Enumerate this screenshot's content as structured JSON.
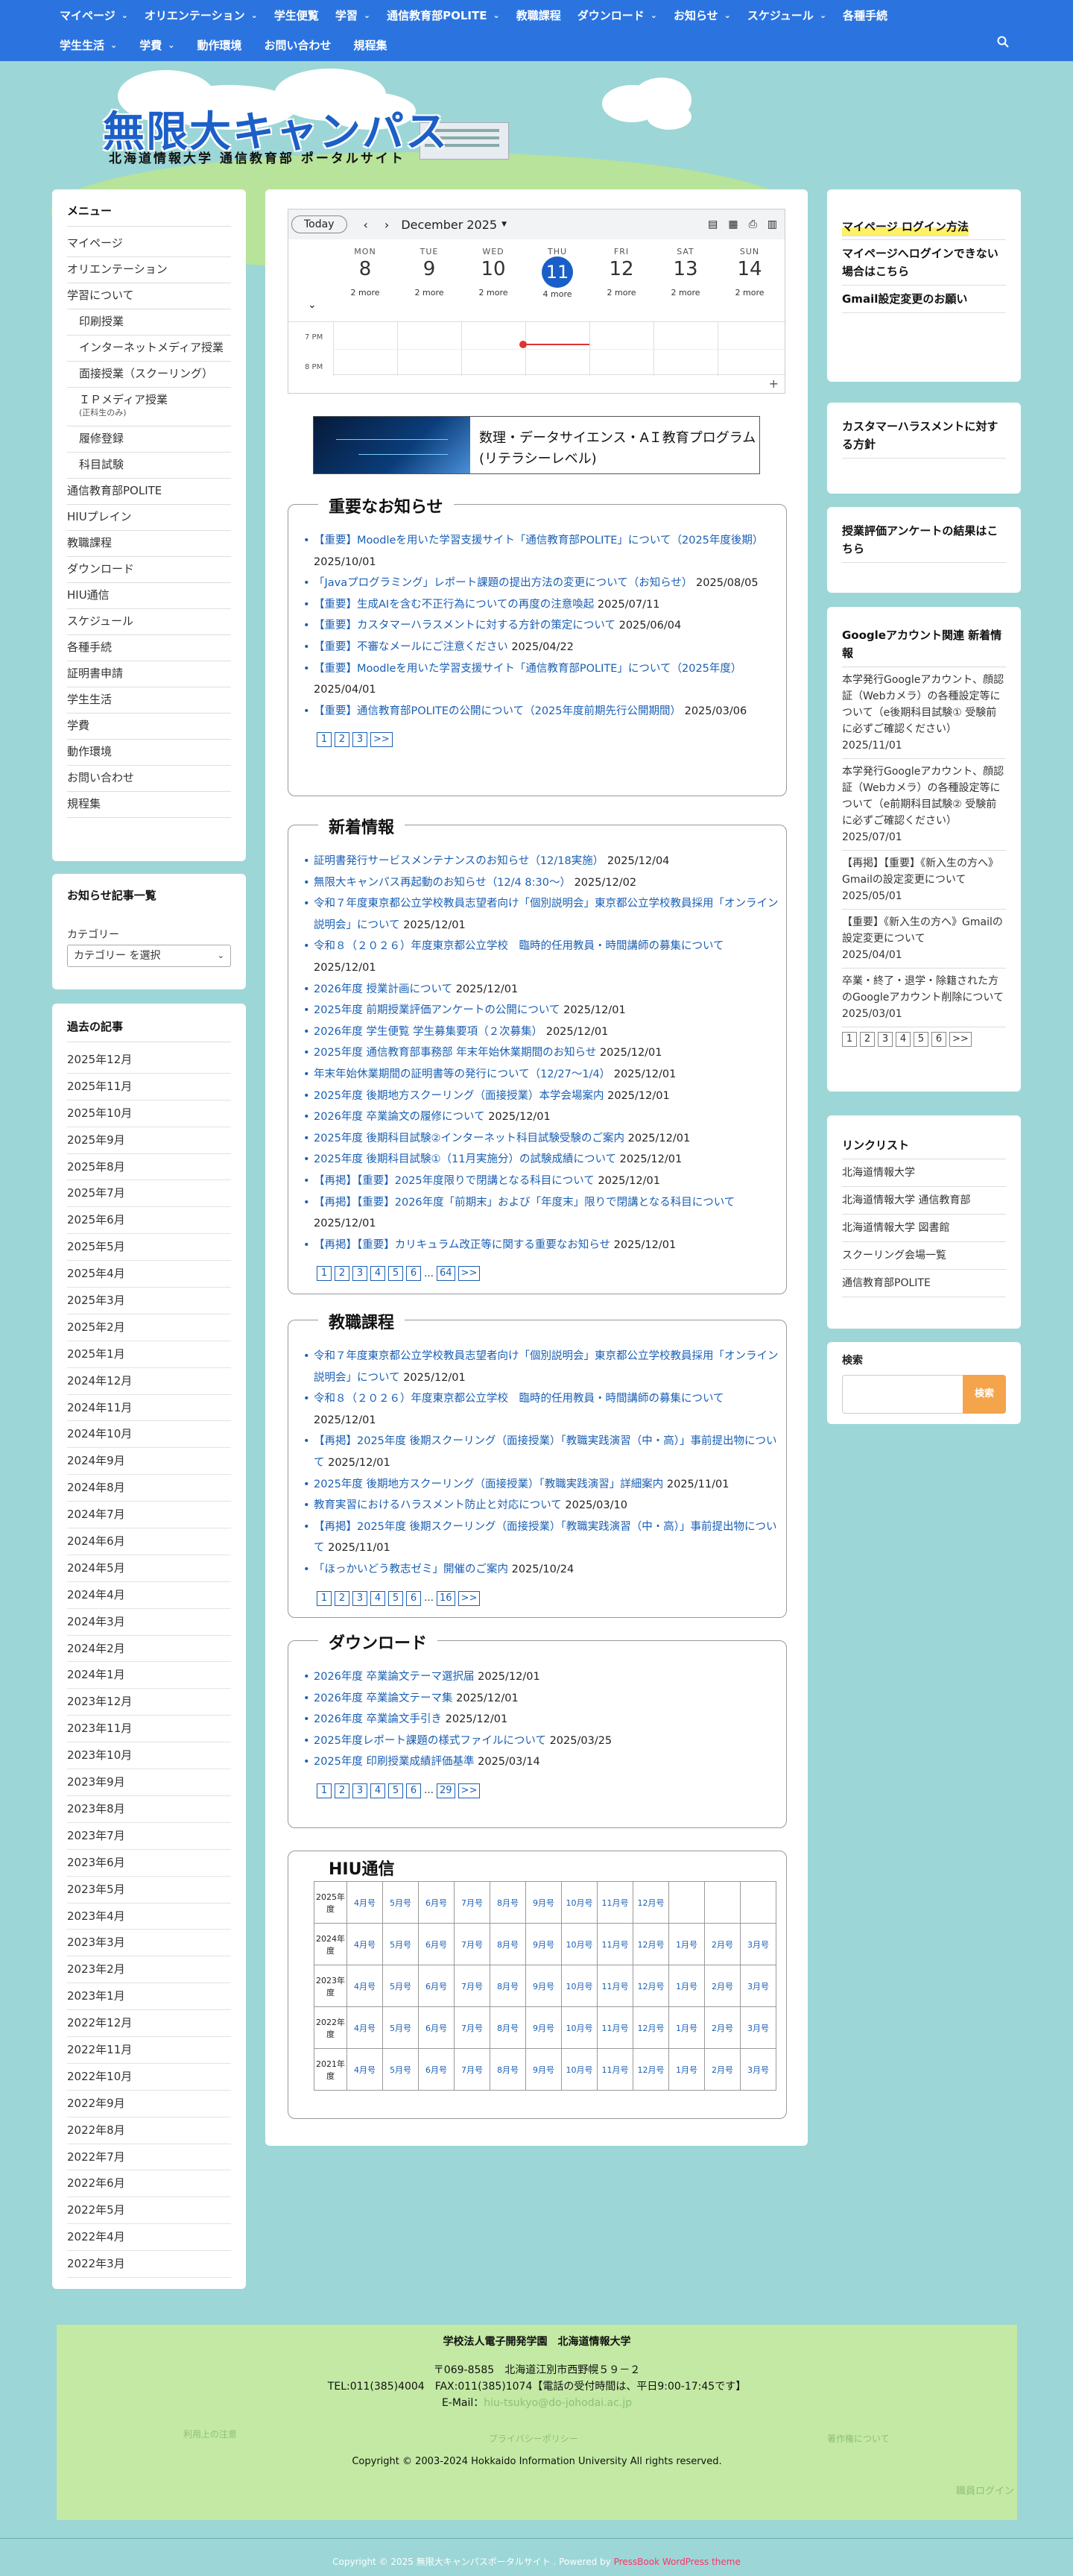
{
  "nav": {
    "row1": [
      "マイページ",
      "オリエンテーション",
      "学生便覧",
      "学習",
      "通信教育部POLITE",
      "教職課程",
      "ダウンロード",
      "お知らせ",
      "スケジュール",
      "各種手続"
    ],
    "row1_dropdown": [
      true,
      true,
      false,
      true,
      true,
      false,
      true,
      true,
      true,
      false
    ],
    "row2": [
      "学生生活",
      "学費",
      "動作環境",
      "お問い合わせ",
      "規程集"
    ],
    "row2_dropdown": [
      true,
      true,
      false,
      false,
      false
    ],
    "search_icon": "search-icon"
  },
  "header": {
    "logo_title": "無限大キャンパス",
    "logo_subtitle": "北海道情報大学 通信教育部 ポータルサイト"
  },
  "left_menu": {
    "title": "メニュー",
    "items": [
      {
        "label": "マイページ",
        "sub": false
      },
      {
        "label": "オリエンテーション",
        "sub": false
      },
      {
        "label": "学習について",
        "sub": false
      },
      {
        "label": "印刷授業",
        "sub": true
      },
      {
        "label": "インターネットメディア授業",
        "sub": true
      },
      {
        "label": "面接授業（スクーリング）",
        "sub": true
      },
      {
        "label": "ＩＰメディア授業",
        "note": "(正科生のみ)",
        "sub": true
      },
      {
        "label": "履修登録",
        "sub": true
      },
      {
        "label": "科目試験",
        "sub": true
      },
      {
        "label": "通信教育部POLITE",
        "sub": false
      },
      {
        "label": "HIUプレイン",
        "sub": false
      },
      {
        "label": "教職課程",
        "sub": false
      },
      {
        "label": "ダウンロード",
        "sub": false
      },
      {
        "label": "HIU通信",
        "sub": false
      },
      {
        "label": "スケジュール",
        "sub": false
      },
      {
        "label": "各種手続",
        "sub": false
      },
      {
        "label": "証明書申請",
        "sub": false
      },
      {
        "label": "学生生活",
        "sub": false
      },
      {
        "label": "学費",
        "sub": false
      },
      {
        "label": "動作環境",
        "sub": false
      },
      {
        "label": "お問い合わせ",
        "sub": false
      },
      {
        "label": "規程集",
        "sub": false
      }
    ]
  },
  "category": {
    "title": "お知らせ記事一覧",
    "label": "カテゴリー",
    "select_value": "カテゴリー を選択"
  },
  "archive": {
    "title": "過去の記事",
    "items": [
      "2025年12月",
      "2025年11月",
      "2025年10月",
      "2025年9月",
      "2025年8月",
      "2025年7月",
      "2025年6月",
      "2025年5月",
      "2025年4月",
      "2025年3月",
      "2025年2月",
      "2025年1月",
      "2024年12月",
      "2024年11月",
      "2024年10月",
      "2024年9月",
      "2024年8月",
      "2024年7月",
      "2024年6月",
      "2024年5月",
      "2024年4月",
      "2024年3月",
      "2024年2月",
      "2024年1月",
      "2023年12月",
      "2023年11月",
      "2023年10月",
      "2023年9月",
      "2023年8月",
      "2023年7月",
      "2023年6月",
      "2023年5月",
      "2023年4月",
      "2023年3月",
      "2023年2月",
      "2023年1月",
      "2022年12月",
      "2022年11月",
      "2022年10月",
      "2022年9月",
      "2022年8月",
      "2022年7月",
      "2022年6月",
      "2022年5月",
      "2022年4月",
      "2022年3月"
    ]
  },
  "calendar": {
    "today_label": "Today",
    "month": "December 2025",
    "days": [
      {
        "name": "MON",
        "num": "8",
        "more": "2 more",
        "today": false
      },
      {
        "name": "TUE",
        "num": "9",
        "more": "2 more",
        "today": false
      },
      {
        "name": "WED",
        "num": "10",
        "more": "2 more",
        "today": false
      },
      {
        "name": "THU",
        "num": "11",
        "more": "4 more",
        "today": true
      },
      {
        "name": "FRI",
        "num": "12",
        "more": "2 more",
        "today": false
      },
      {
        "name": "SAT",
        "num": "13",
        "more": "2 more",
        "today": false
      },
      {
        "name": "SUN",
        "num": "14",
        "more": "2 more",
        "today": false
      }
    ],
    "times": [
      "7 PM",
      "8 PM"
    ],
    "plus": "+"
  },
  "banner": {
    "line1": "数理・データサイエンス・AＩ教育プログラム",
    "line2": "(リテラシーレベル)"
  },
  "important": {
    "title": "重要なお知らせ",
    "items": [
      {
        "text": "【重要】Moodleを用いた学習支援サイト「通信教育部POLITE」について（2025年度後期）",
        "date": "2025/10/01"
      },
      {
        "text": "「Javaプログラミング」レポート課題の提出方法の変更について（お知らせ）",
        "date": "2025/08/05"
      },
      {
        "text": "【重要】生成AIを含む不正行為についての再度の注意喚起",
        "date": "2025/07/11"
      },
      {
        "text": "【重要】カスタマーハラスメントに対する方針の策定について",
        "date": "2025/06/04"
      },
      {
        "text": "【重要】不審なメールにご注意ください",
        "date": "2025/04/22"
      },
      {
        "text": "【重要】Moodleを用いた学習支援サイト「通信教育部POLITE」について（2025年度）",
        "date": "2025/04/01"
      },
      {
        "text": "【重要】通信教育部POLITEの公開について（2025年度前期先行公開期間）",
        "date": "2025/03/06"
      }
    ],
    "pages": [
      "1",
      "2",
      "3",
      ">>"
    ]
  },
  "news": {
    "title": "新着情報",
    "items": [
      {
        "text": "証明書発行サービスメンテナンスのお知らせ（12/18実施）",
        "date": "2025/12/04"
      },
      {
        "text": "無限大キャンパス再起動のお知らせ（12/4 8:30～）",
        "date": "2025/12/02"
      },
      {
        "text": "令和７年度東京都公立学校教員志望者向け「個別説明会」東京都公立学校教員採用「オンライン説明会」について",
        "date": "2025/12/01"
      },
      {
        "text": "令和８（２０２６）年度東京都公立学校　臨時的任用教員・時間講師の募集について",
        "date": "2025/12/01"
      },
      {
        "text": "2026年度 授業計画について",
        "date": "2025/12/01"
      },
      {
        "text": "2025年度 前期授業評価アンケートの公開について",
        "date": "2025/12/01"
      },
      {
        "text": "2026年度 学生便覧 学生募集要項（２次募集）",
        "date": "2025/12/01"
      },
      {
        "text": "2025年度 通信教育部事務部 年末年始休業期間のお知らせ",
        "date": "2025/12/01"
      },
      {
        "text": "年末年始休業期間の証明書等の発行について（12/27〜1/4）",
        "date": "2025/12/01"
      },
      {
        "text": "2025年度 後期地方スクーリング（面接授業）本学会場案内",
        "date": "2025/12/01"
      },
      {
        "text": "2026年度 卒業論文の履修について",
        "date": "2025/12/01"
      },
      {
        "text": "2025年度 後期科目試験②インターネット科目試験受験のご案内",
        "date": "2025/12/01"
      },
      {
        "text": "2025年度 後期科目試験①（11月実施分）の試験成績について",
        "date": "2025/12/01"
      },
      {
        "text": "【再掲】【重要】2025年度限りで閉講となる科目について",
        "date": "2025/12/01"
      },
      {
        "text": "【再掲】【重要】2026年度「前期末」および「年度末」限りで閉講となる科目について",
        "date": "2025/12/01"
      },
      {
        "text": "【再掲】【重要】カリキュラム改正等に関する重要なお知らせ",
        "date": "2025/12/01"
      }
    ],
    "pages": [
      "1",
      "2",
      "3",
      "4",
      "5",
      "6",
      "…",
      "64",
      ">>"
    ]
  },
  "teacher": {
    "title": "教職課程",
    "items": [
      {
        "text": "令和７年度東京都公立学校教員志望者向け「個別説明会」東京都公立学校教員採用「オンライン説明会」について",
        "date": "2025/12/01"
      },
      {
        "text": "令和８（２０２６）年度東京都公立学校　臨時的任用教員・時間講師の募集について",
        "date": "2025/12/01"
      },
      {
        "text": "【再掲】2025年度 後期スクーリング（面接授業）「教職実践演習（中・高）」事前提出物について",
        "date": "2025/12/01"
      },
      {
        "text": "2025年度 後期地方スクーリング（面接授業）「教職実践演習」詳細案内",
        "date": "2025/11/01"
      },
      {
        "text": "教育実習におけるハラスメント防止と対応について",
        "date": "2025/03/10"
      },
      {
        "text": "【再掲】2025年度 後期スクーリング（面接授業）「教職実践演習（中・高）」事前提出物について",
        "date": "2025/11/01"
      },
      {
        "text": "「ほっかいどう教志ゼミ」開催のご案内",
        "date": "2025/10/24"
      }
    ],
    "pages": [
      "1",
      "2",
      "3",
      "4",
      "5",
      "6",
      "…",
      "16",
      ">>"
    ]
  },
  "download": {
    "title": "ダウンロード",
    "items": [
      {
        "text": "2026年度 卒業論文テーマ選択届",
        "date": "2025/12/01"
      },
      {
        "text": "2026年度 卒業論文テーマ集",
        "date": "2025/12/01"
      },
      {
        "text": "2026年度 卒業論文手引き",
        "date": "2025/12/01"
      },
      {
        "text": "2025年度レポート課題の様式ファイルについて",
        "date": "2025/03/25"
      },
      {
        "text": "2025年度 印刷授業成績評価基準",
        "date": "2025/03/14"
      }
    ],
    "pages": [
      "1",
      "2",
      "3",
      "4",
      "5",
      "6",
      "…",
      "29",
      ">>"
    ]
  },
  "hiu": {
    "title": "HIU通信",
    "rows": [
      {
        "year": "2025年度",
        "months": [
          "4月号",
          "5月号",
          "6月号",
          "7月号",
          "8月号",
          "9月号",
          "10月号",
          "11月号",
          "12月号",
          "",
          "",
          ""
        ]
      },
      {
        "year": "2024年度",
        "months": [
          "4月号",
          "5月号",
          "6月号",
          "7月号",
          "8月号",
          "9月号",
          "10月号",
          "11月号",
          "12月号",
          "1月号",
          "2月号",
          "3月号"
        ]
      },
      {
        "year": "2023年度",
        "months": [
          "4月号",
          "5月号",
          "6月号",
          "7月号",
          "8月号",
          "9月号",
          "10月号",
          "11月号",
          "12月号",
          "1月号",
          "2月号",
          "3月号"
        ]
      },
      {
        "year": "2022年度",
        "months": [
          "4月号",
          "5月号",
          "6月号",
          "7月号",
          "8月号",
          "9月号",
          "10月号",
          "11月号",
          "12月号",
          "1月号",
          "2月号",
          "3月号"
        ]
      },
      {
        "year": "2021年度",
        "months": [
          "4月号",
          "5月号",
          "6月号",
          "7月号",
          "8月号",
          "9月号",
          "10月号",
          "11月号",
          "12月号",
          "1月号",
          "2月号",
          "3月号"
        ]
      }
    ]
  },
  "right": {
    "login_title": "マイページ ログイン方法",
    "login_help": "マイページへログインできない場合はこちら",
    "gmail": "Gmail設定変更のお願い",
    "harass": "カスタマーハラスメントに対する方針",
    "survey": "授業評価アンケートの結果はこちら",
    "google_title": "Googleアカウント関連 新着情報",
    "google_items": [
      {
        "text": "本学発行Googleアカウント、顔認証（Webカメラ）の各種設定等について（e後期科目試験① 受験前に必ずご確認ください）",
        "date": "2025/11/01"
      },
      {
        "text": "本学発行Googleアカウント、顔認証（Webカメラ）の各種設定等について（e前期科目試験② 受験前に必ずご確認ください）",
        "date": "2025/07/01"
      },
      {
        "text": "【再掲】【重要】《新入生の方へ》Gmailの設定変更について",
        "date": "2025/05/01"
      },
      {
        "text": "【重要】《新入生の方へ》Gmailの設定変更について",
        "date": "2025/04/01"
      },
      {
        "text": "卒業・終了・退学・除籍された方のGoogleアカウント削除について",
        "date": "2025/03/01"
      }
    ],
    "google_pages": [
      "1",
      "2",
      "3",
      "4",
      "5",
      "6",
      ">>"
    ],
    "links_title": "リンクリスト",
    "links": [
      "北海道情報大学",
      "北海道情報大学 通信教育部",
      "北海道情報大学 図書館",
      "スクーリング会場一覧",
      "通信教育部POLITE"
    ],
    "search_title": "検索",
    "search_button": "検索"
  },
  "footer": {
    "org": "学校法人電子開発学園　北海道情報大学",
    "address1": "〒069-8585　北海道江別市西野幌５９－２",
    "address2": "TEL:011(385)4004　FAX:011(385)1074【電話の受付時間は、平日9:00-17:45です】",
    "email_label": "E-Mail：",
    "email": "hiu-tsukyo@do-johodai.ac.jp",
    "left_link": "利用上の注意",
    "mid_link": "プライバシーポリシー",
    "right_link": "著作権について",
    "copyright": "Copyright © 2003-2024 Hokkaido Information University All rights reserved.",
    "admin_link": "職員ログイン",
    "bottom": "Copyright © 2025 無限大キャンパスポータルサイト . Powered by",
    "bottom_link": "PressBook WordPress theme"
  }
}
